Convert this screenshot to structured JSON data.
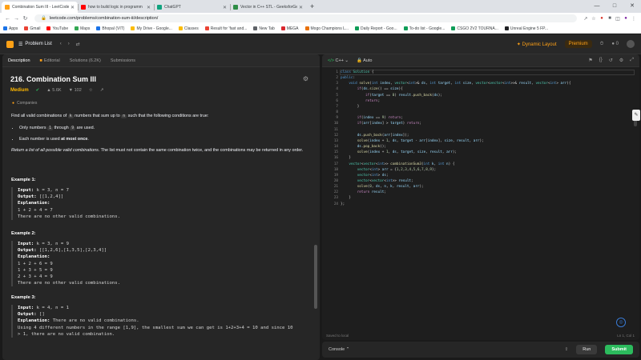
{
  "browser": {
    "tabs": [
      {
        "title": "Combination Sum III - LeetCode",
        "color": "#ffa116",
        "active": true
      },
      {
        "title": "how to build logic in programm",
        "color": "#ff0000",
        "active": false
      },
      {
        "title": "ChatGPT",
        "color": "#10a37f",
        "active": false
      },
      {
        "title": "Vector in C++ STL - GeeksforGe",
        "color": "#2f8d46",
        "active": false
      }
    ],
    "url": "leetcode.com/problems/combination-sum-iii/description/",
    "bookmarks": [
      {
        "label": "Apps",
        "color": "#1a73e8"
      },
      {
        "label": "Gmail",
        "color": "#ea4335"
      },
      {
        "label": "YouTube",
        "color": "#ff0000"
      },
      {
        "label": "Maps",
        "color": "#34a853"
      },
      {
        "label": "Bhopal (VIT)",
        "color": "#1a73e8"
      },
      {
        "label": "My Drive - Google...",
        "color": "#fbbc04"
      },
      {
        "label": "Classes",
        "color": "#fbbc04"
      },
      {
        "label": "Result for 'fast and...",
        "color": "#ea4335"
      },
      {
        "label": "New Tab",
        "color": "#5f6368"
      },
      {
        "label": "MEGA",
        "color": "#d9272e"
      },
      {
        "label": "Mogo Champions L...",
        "color": "#e8710a"
      },
      {
        "label": "Daily Report - Goo...",
        "color": "#0f9d58"
      },
      {
        "label": "To-do list - Google...",
        "color": "#0f9d58"
      },
      {
        "label": "CSGO 2V2 TOURNA...",
        "color": "#0f9d58"
      },
      {
        "label": "Unreal Engine 5 FP...",
        "color": "#202124"
      }
    ]
  },
  "nav": {
    "problem_list": "Problem List",
    "dynamic_layout": "Dynamic Layout",
    "premium": "Premium",
    "notif_count": "0"
  },
  "left_tabs": [
    "Description",
    "Editorial",
    "Solutions (6.2K)",
    "Submissions"
  ],
  "problem": {
    "title": "216. Combination Sum III",
    "difficulty": "Medium",
    "likes": "5.6K",
    "dislikes": "102",
    "companies": "Companies",
    "intro_1": "Find all valid combinations of ",
    "intro_k": "k",
    "intro_2": " numbers that sum up to ",
    "intro_n": "n",
    "intro_3": " such that the following conditions are true:",
    "bullet1_a": "Only numbers ",
    "bullet1_1": "1",
    "bullet1_b": " through ",
    "bullet1_9": "9",
    "bullet1_c": " are used.",
    "bullet2_a": "Each number is used ",
    "bullet2_b": "at most once",
    "bullet2_c": ".",
    "return_a": "Return a list of all possible valid combinations.",
    "return_b": " The list must not contain the same combination twice, and the combinations may be returned in any order."
  },
  "examples": [
    {
      "heading": "Example 1:",
      "input_label": "Input:",
      "input": " k = 3, n = 7",
      "output_label": "Output:",
      "output": " [[1,2,4]]",
      "expl_label": "Explanation:",
      "lines": [
        "1 + 2 + 4 = 7",
        "There are no other valid combinations."
      ]
    },
    {
      "heading": "Example 2:",
      "input_label": "Input:",
      "input": " k = 3, n = 9",
      "output_label": "Output:",
      "output": " [[1,2,6],[1,3,5],[2,3,4]]",
      "expl_label": "Explanation:",
      "lines": [
        "1 + 2 + 6 = 9",
        "1 + 3 + 5 = 9",
        "2 + 3 + 4 = 9",
        "There are no other valid combinations."
      ]
    },
    {
      "heading": "Example 3:",
      "input_label": "Input:",
      "input": " k = 4, n = 1",
      "output_label": "Output:",
      "output": " []",
      "expl_label": "Explanation:",
      "expl_inline": " There are no valid combinations.",
      "lines": [
        "Using 4 different numbers in the range [1,9], the smallest sum we can get is 1+2+3+4 = 10 and since 10",
        "> 1, there are no valid combination."
      ]
    }
  ],
  "editor": {
    "language": "C++",
    "mode": "Auto",
    "saved": "Saved to local",
    "cursor": "Ln 1, Col 1",
    "line_count": 24
  },
  "console": {
    "label": "Console",
    "run": "Run",
    "submit": "Submit"
  }
}
